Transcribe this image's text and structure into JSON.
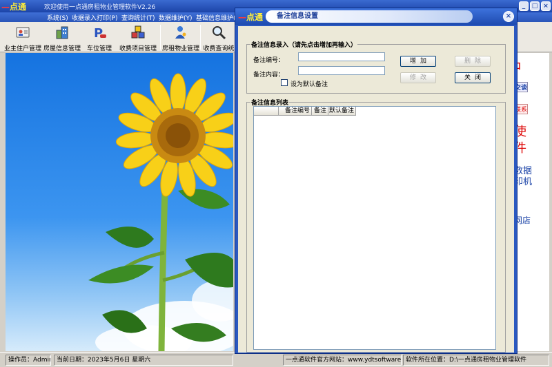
{
  "main_window": {
    "logo_text": "点通",
    "title": "欢迎使用一点通房租物业管理软件V2.26",
    "window_buttons": [
      "_",
      "□",
      "×"
    ]
  },
  "menu": [
    {
      "label": "系统(S)"
    },
    {
      "label": "收据录入打印(P)"
    },
    {
      "label": "查询统计(T)"
    },
    {
      "label": "数据维护(Y)"
    },
    {
      "label": "基础信息维护("
    }
  ],
  "toolbar": [
    {
      "label": "业主住户管理",
      "icon": "id-card-icon"
    },
    {
      "label": "房屋信息管理",
      "icon": "building-icon"
    },
    {
      "label": "车位管理",
      "icon": "parking-icon"
    },
    {
      "label": "收费项目管理",
      "icon": "cubes-icon"
    },
    {
      "label": "房租物业管理",
      "icon": "person-key-icon"
    },
    {
      "label": "收费查询统",
      "icon": "magnifier-icon"
    }
  ],
  "right_panel": {
    "items": [
      "口",
      "交谈",
      "联系",
      "使",
      "件",
      "数据",
      "印机",
      "网店"
    ]
  },
  "statusbar": {
    "operator": "操作员：Admin",
    "date": "当前日期：2023年5月6日 星期六",
    "website": "一点通软件官方网站：www.ydtsoftware.com",
    "path": "软件所在位置：D:\\一点通房租物业管理软件"
  },
  "dialog": {
    "logo_text": "点通",
    "title": "备注信息设置",
    "close_label": "×",
    "entry_group": {
      "label": "备注信息录入（请先点击增加再输入）",
      "code_label": "备注编号：",
      "code_value": "",
      "content_label": "备注内容：",
      "content_value": "",
      "default_checkbox_label": "设为默认备注",
      "default_checked": false
    },
    "buttons": {
      "add": "增加",
      "delete": "删除",
      "modify": "修改",
      "close": "关闭"
    },
    "list_group": {
      "label": "备注信息列表",
      "columns": [
        "",
        "备注编号",
        "备注",
        "默认备注"
      ],
      "rows": []
    }
  }
}
